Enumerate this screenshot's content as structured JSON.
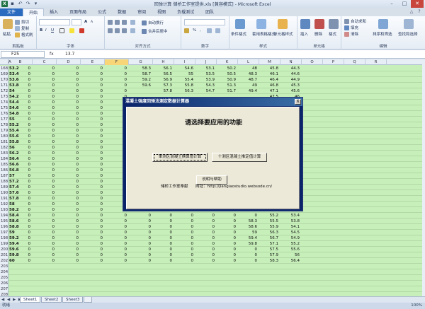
{
  "window": {
    "title": "回弹计算 储桥工作室提供.xls [兼容模式] - Microsoft Excel",
    "app_letter": "X"
  },
  "tabs": [
    "文件",
    "开始",
    "插入",
    "页面布局",
    "公式",
    "数据",
    "审阅",
    "视图",
    "负载测试",
    "团队"
  ],
  "ribbon": {
    "clipboard": {
      "label": "剪贴板",
      "paste": "粘贴",
      "cut": "剪切",
      "copy": "复制",
      "format_painter": "格式刷"
    },
    "font": {
      "label": "字体",
      "bold": "B",
      "italic": "I",
      "underline": "U",
      "grow": "A",
      "shrink": "A"
    },
    "alignment": {
      "label": "对齐方式",
      "wrap": "自动换行",
      "merge": "合并后居中"
    },
    "number": {
      "label": "数字",
      "percent": "%",
      "comma": ","
    },
    "styles": {
      "label": "样式",
      "conditional": "条件格式",
      "table": "套用表格格式",
      "cell": "单元格样式"
    },
    "cells": {
      "label": "单元格",
      "insert": "插入",
      "delete": "删除",
      "format": "格式"
    },
    "editing": {
      "label": "编辑",
      "autosum": "自动求和",
      "fill": "填充",
      "clear": "清除",
      "sort": "排序和筛选",
      "find": "查找和选择"
    }
  },
  "formula_bar": {
    "name_box": "F25",
    "fx": "fx",
    "value": "13.7"
  },
  "columns": [
    "A",
    "B",
    "C",
    "D",
    "E",
    "F",
    "G",
    "H",
    "I",
    "J",
    "K",
    "L",
    "M",
    "N",
    "O",
    "P",
    "Q",
    "R"
  ],
  "selected_column": "F",
  "rows": [
    {
      "n": "168",
      "a": "53.2",
      "g": "58.3",
      "h": "56.1",
      "i": "54.6",
      "j": "53.1",
      "k": "50.2",
      "l": "48",
      "m": "45.8",
      "n2": "44.3"
    },
    {
      "n": "169",
      "a": "53.4",
      "g": "58.7",
      "h": "56.5",
      "i": "55",
      "j": "53.5",
      "k": "50.5",
      "l": "48.3",
      "m": "46.1",
      "n2": "44.6"
    },
    {
      "n": "170",
      "a": "53.6",
      "g": "59.2",
      "h": "56.9",
      "i": "55.4",
      "j": "53.9",
      "k": "50.9",
      "l": "48.7",
      "m": "46.4",
      "n2": "44.9"
    },
    {
      "n": "171",
      "a": "53.8",
      "g": "59.6",
      "h": "57.3",
      "i": "55.8",
      "j": "54.3",
      "k": "51.3",
      "l": "49",
      "m": "46.8",
      "n2": "45.3"
    },
    {
      "n": "172",
      "a": "54",
      "g": "",
      "h": "57.8",
      "i": "56.3",
      "j": "54.7",
      "k": "51.7",
      "l": "49.4",
      "m": "47.1",
      "n2": "45.6"
    },
    {
      "n": "173",
      "a": "54.2",
      "g": "",
      "h": "",
      "i": "",
      "j": "",
      "k": "",
      "l": "",
      "m": "47.5",
      "n2": "46"
    },
    {
      "n": "174",
      "a": "54.4",
      "g": "",
      "h": "",
      "i": "",
      "j": "",
      "k": "",
      "l": "",
      "m": "47.8",
      "n2": "46.3"
    },
    {
      "n": "175",
      "a": "54.6",
      "g": "",
      "h": "",
      "i": "",
      "j": "",
      "k": "",
      "l": "",
      "m": "48.2",
      "n2": "46.7"
    },
    {
      "n": "176",
      "a": "54.8",
      "g": "",
      "h": "",
      "i": "",
      "j": "",
      "k": "",
      "l": "",
      "m": "48.5",
      "n2": "47"
    },
    {
      "n": "177",
      "a": "55",
      "g": "",
      "h": "",
      "i": "",
      "j": "",
      "k": "",
      "l": "",
      "m": "48.9",
      "n2": "47.3"
    },
    {
      "n": "178",
      "a": "55.2",
      "g": "",
      "h": "",
      "i": "",
      "j": "",
      "k": "",
      "l": "",
      "m": "49.3",
      "n2": "47.7"
    },
    {
      "n": "179",
      "a": "55.4",
      "g": "",
      "h": "",
      "i": "",
      "j": "",
      "k": "",
      "l": "",
      "m": "49.6",
      "n2": "48"
    },
    {
      "n": "180",
      "a": "55.6",
      "g": "",
      "h": "",
      "i": "",
      "j": "",
      "k": "",
      "l": "",
      "m": "50",
      "n2": "48.4"
    },
    {
      "n": "181",
      "a": "55.8",
      "g": "",
      "h": "",
      "i": "",
      "j": "",
      "k": "",
      "l": "",
      "m": "50.3",
      "n2": "48.7"
    },
    {
      "n": "182",
      "a": "56",
      "g": "",
      "h": "",
      "i": "",
      "j": "",
      "k": "",
      "l": "",
      "m": "50.7",
      "n2": "49.1"
    },
    {
      "n": "183",
      "a": "56.2",
      "g": "",
      "h": "",
      "i": "",
      "j": "",
      "k": "",
      "l": "",
      "m": "51.1",
      "n2": "49.4"
    },
    {
      "n": "184",
      "a": "56.4",
      "g": "",
      "h": "",
      "i": "",
      "j": "",
      "k": "",
      "l": "",
      "m": "51.4",
      "n2": "49.8"
    },
    {
      "n": "185",
      "a": "56.6",
      "g": "",
      "h": "",
      "i": "",
      "j": "",
      "k": "",
      "l": "",
      "m": "51.8",
      "n2": "50.1"
    },
    {
      "n": "186",
      "a": "56.8",
      "g": "",
      "h": "",
      "i": "",
      "j": "",
      "k": "",
      "l": "",
      "m": "52.2",
      "n2": "50.5"
    },
    {
      "n": "187",
      "a": "57",
      "g": "",
      "h": "",
      "i": "",
      "j": "",
      "k": "",
      "l": "",
      "m": "52.5",
      "n2": "50.8"
    },
    {
      "n": "188",
      "a": "57.2",
      "g": "",
      "h": "",
      "i": "",
      "j": "",
      "k": "",
      "l": "",
      "m": "52.9",
      "n2": "51.2"
    },
    {
      "n": "189",
      "a": "57.4",
      "g": "",
      "h": "",
      "i": "",
      "j": "",
      "k": "",
      "l": "",
      "m": "53.3",
      "n2": "51.6"
    },
    {
      "n": "190",
      "a": "57.6",
      "g": "",
      "h": "",
      "i": "",
      "j": "",
      "k": "",
      "l": "",
      "m": "53.6",
      "n2": "51.9"
    },
    {
      "n": "191",
      "a": "57.8",
      "g": "",
      "h": "",
      "i": "",
      "j": "",
      "k": "",
      "l": "",
      "m": "54",
      "n2": "52.3"
    },
    {
      "n": "192",
      "a": "58",
      "g": "",
      "h": "",
      "i": "",
      "j": "",
      "k": "",
      "l": "",
      "m": "54.4",
      "n2": "52.7"
    },
    {
      "n": "193",
      "a": "58.2",
      "g": "",
      "h": "",
      "i": "",
      "j": "",
      "k": "",
      "l": "",
      "m": "54.8",
      "n2": "53"
    },
    {
      "n": "194",
      "a": "58.4",
      "g": "0",
      "h": "0",
      "i": "0",
      "j": "0",
      "k": "0",
      "l": "0",
      "m": "55.2",
      "n2": "53.4"
    },
    {
      "n": "195",
      "a": "58.6",
      "g": "0",
      "h": "0",
      "i": "0",
      "j": "0",
      "k": "0",
      "l": "58.3",
      "m": "55.5",
      "n2": "53.8"
    },
    {
      "n": "196",
      "a": "58.8",
      "g": "0",
      "h": "0",
      "i": "0",
      "j": "0",
      "k": "0",
      "l": "58.6",
      "m": "55.9",
      "n2": "54.1"
    },
    {
      "n": "197",
      "a": "59",
      "g": "0",
      "h": "0",
      "i": "0",
      "j": "0",
      "k": "0",
      "l": "59",
      "m": "56.3",
      "n2": "54.5"
    },
    {
      "n": "198",
      "a": "59.2",
      "g": "0",
      "h": "0",
      "i": "0",
      "j": "0",
      "k": "0",
      "l": "59.4",
      "m": "56.7",
      "n2": "54.9"
    },
    {
      "n": "199",
      "a": "59.4",
      "g": "0",
      "h": "0",
      "i": "0",
      "j": "0",
      "k": "0",
      "l": "59.8",
      "m": "57.1",
      "n2": "55.2"
    },
    {
      "n": "200",
      "a": "59.6",
      "g": "0",
      "h": "0",
      "i": "0",
      "j": "0",
      "k": "0",
      "l": "0",
      "m": "57.5",
      "n2": "55.6"
    },
    {
      "n": "201",
      "a": "59.8",
      "g": "0",
      "h": "0",
      "i": "0",
      "j": "0",
      "k": "0",
      "l": "0",
      "m": "57.9",
      "n2": "56"
    },
    {
      "n": "202",
      "a": "60",
      "g": "0",
      "h": "0",
      "i": "0",
      "j": "0",
      "k": "0",
      "l": "0",
      "m": "58.3",
      "n2": "56.4"
    },
    {
      "n": "203"
    },
    {
      "n": "204"
    },
    {
      "n": "205"
    },
    {
      "n": "206"
    },
    {
      "n": "207"
    },
    {
      "n": "208"
    },
    {
      "n": "209"
    },
    {
      "n": "210"
    },
    {
      "n": "211"
    },
    {
      "n": "212"
    }
  ],
  "sheet_tabs": [
    "Sheet1",
    "Sheet2",
    "Sheet3"
  ],
  "sheet_nav": "◀ ◀ ▶ ▶",
  "statusbar": {
    "ready": "就绪",
    "zoom": "100%"
  },
  "dialog": {
    "title": "混凝土强度回弹法测定数据计算器",
    "heading": "请选择要应用的功能",
    "btn_single": "单测区混凝土换算值计算",
    "btn_ten": "十测区混凝土推定值计算",
    "btn_help": "说明与帮助",
    "footer_author": "储桥工作室奉献",
    "footer_site": "网址：http://jiangiaostudio.websode.cn/",
    "close": "X"
  },
  "colors": {
    "sheet_bg": "#c6efb9",
    "selected_col": "#f8d677",
    "dialog_bg": "#ece9d8",
    "dialog_title": "#0a246a"
  }
}
